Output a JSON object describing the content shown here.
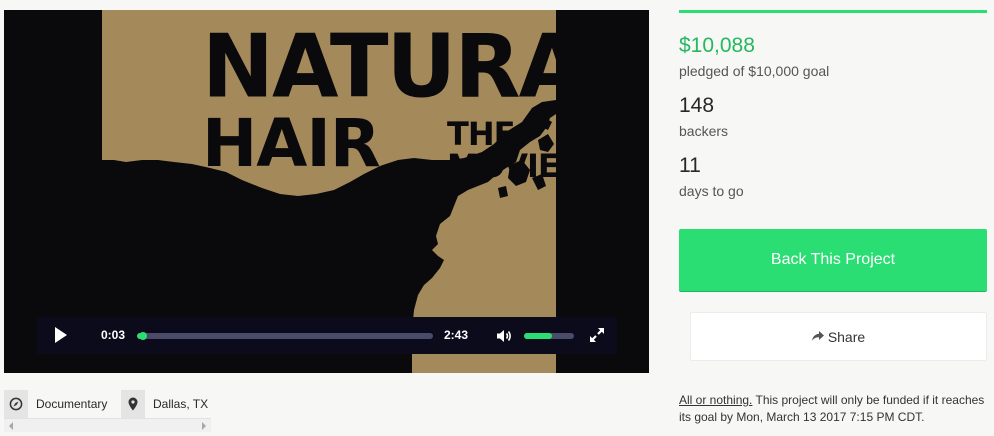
{
  "video": {
    "poster_title_line1": "NATURAL",
    "poster_title_line2": "HAIR",
    "poster_title_line3": "THE MOVIE",
    "current_time": "0:03",
    "duration": "2:43",
    "progress_fraction": 0.02,
    "volume_fraction": 0.55,
    "icons": [
      "play-icon",
      "volume-icon",
      "fullscreen-icon"
    ]
  },
  "stats": {
    "pledged_amount": "$10,088",
    "pledged_label": "pledged of $10,000 goal",
    "backers_count": "148",
    "backers_label": "backers",
    "days_count": "11",
    "days_label": "days to go"
  },
  "actions": {
    "back_label": "Back This Project",
    "share_label": "Share"
  },
  "note": {
    "link_text": "All or nothing.",
    "text": " This project will only be funded if it reaches its goal by Mon, March 13 2017 7:15 PM CDT."
  },
  "tags": {
    "category": "Documentary",
    "location": "Dallas, TX"
  },
  "colors": {
    "accent": "#2bde73",
    "pledged_text": "#25b85e",
    "poster_gold": "#a4895b",
    "video_bg": "#0a0a0c",
    "controls_bg": "#0b0b1c"
  }
}
